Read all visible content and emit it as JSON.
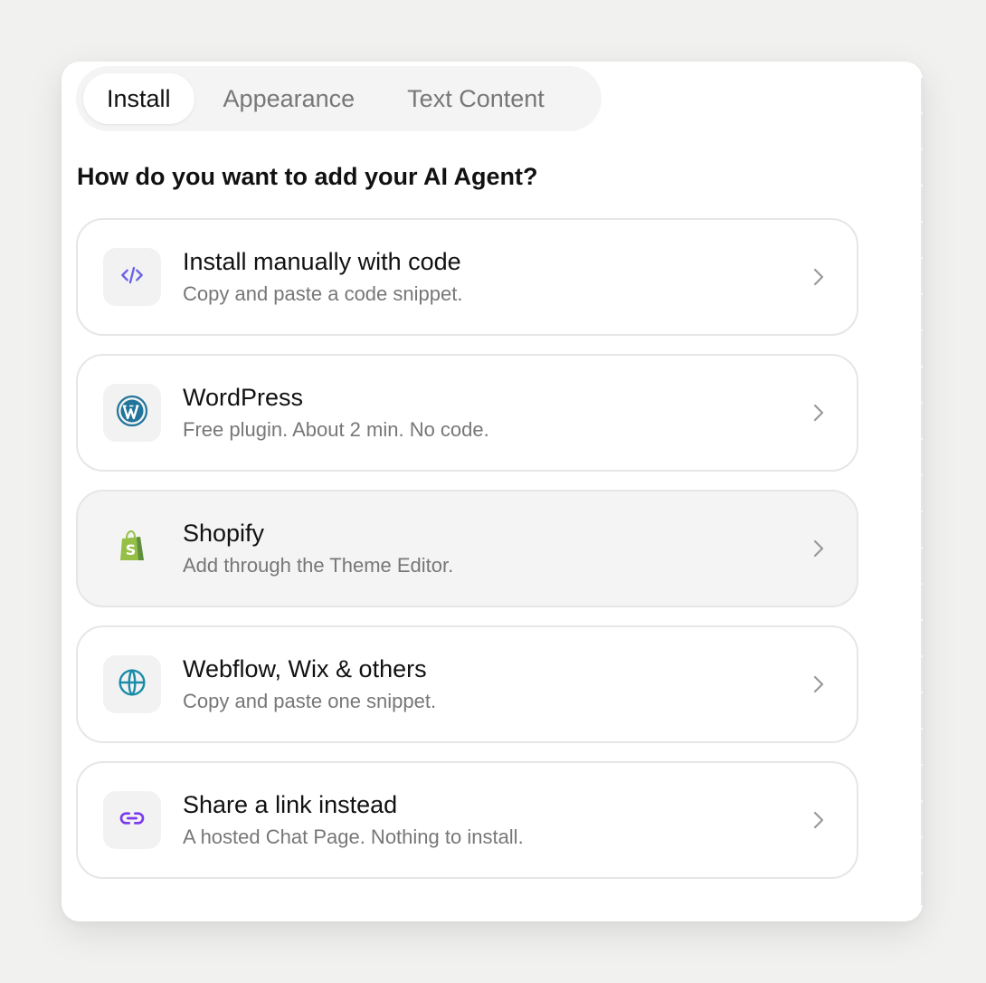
{
  "tabs": [
    {
      "label": "Install",
      "active": true
    },
    {
      "label": "Appearance",
      "active": false
    },
    {
      "label": "Text Content",
      "active": false
    }
  ],
  "question": "How do you want to add your AI Agent?",
  "options": [
    {
      "title": "Install manually with code",
      "description": "Copy and paste a code snippet.",
      "icon": "code-icon",
      "icon_color": "#6b63e8"
    },
    {
      "title": "WordPress",
      "description": "Free plugin. About 2 min. No code.",
      "icon": "wordpress-icon",
      "icon_color": "#21759b"
    },
    {
      "title": "Shopify",
      "description": "Add through the Theme Editor.",
      "icon": "shopify-icon",
      "icon_color": "#95bf47",
      "highlighted": true
    },
    {
      "title": "Webflow, Wix & others",
      "description": "Copy and paste one snippet.",
      "icon": "globe-icon",
      "icon_color": "#1a8ca8"
    },
    {
      "title": "Share a link instead",
      "description": "A hosted Chat Page. Nothing to install.",
      "icon": "link-icon",
      "icon_color": "#7c3aed"
    }
  ],
  "colors": {
    "background": "#f1f1f0",
    "panel": "#ffffff",
    "tab_bar": "#f4f4f4",
    "border": "#e6e6e6",
    "text_primary": "#111111",
    "text_secondary": "#777777"
  }
}
